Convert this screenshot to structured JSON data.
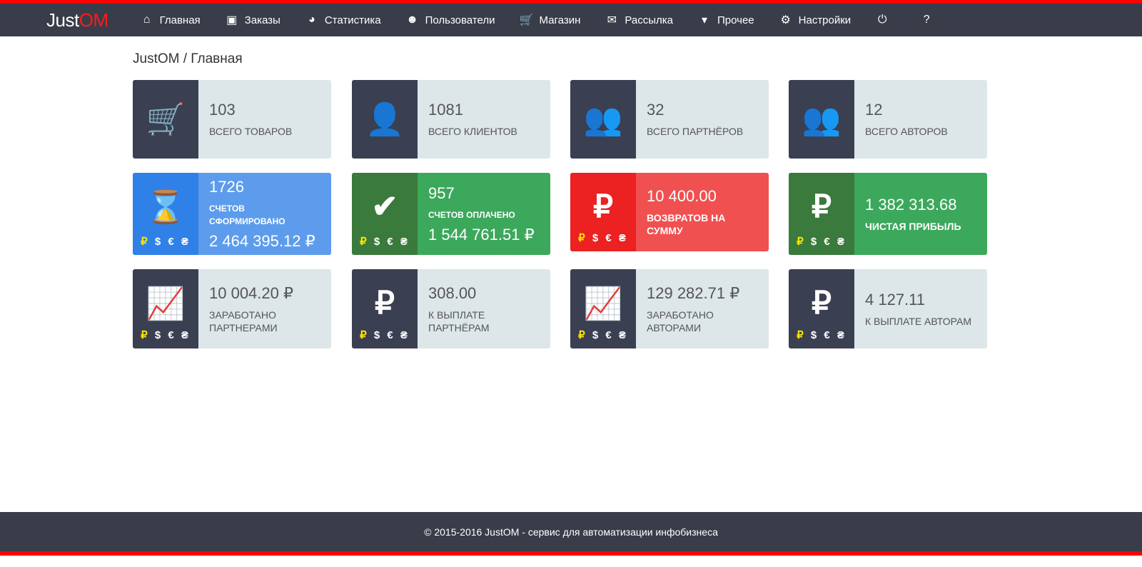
{
  "app": {
    "logo_a": "Just",
    "logo_b": "OM"
  },
  "nav": [
    {
      "icon": "home-icon",
      "glyph": "⌂",
      "label": "Главная"
    },
    {
      "icon": "money-icon",
      "glyph": "▣",
      "label": "Заказы"
    },
    {
      "icon": "pie-chart-icon",
      "glyph": "◕",
      "label": "Статистика"
    },
    {
      "icon": "users-icon",
      "glyph": "☻",
      "label": "Пользователи"
    },
    {
      "icon": "cart-icon",
      "glyph": "🛒",
      "label": "Магазин"
    },
    {
      "icon": "envelope-icon",
      "glyph": "✉",
      "label": "Рассылка"
    },
    {
      "icon": "dropdown-icon",
      "glyph": "▾",
      "label": "Прочее"
    },
    {
      "icon": "gears-icon",
      "glyph": "⚙",
      "label": "Настройки"
    },
    {
      "icon": "power-icon",
      "glyph": "⏻",
      "label": ""
    },
    {
      "icon": "help-icon",
      "glyph": "?",
      "label": ""
    }
  ],
  "breadcrumb": "JustOM / Главная",
  "currencies": [
    "₽",
    "$",
    "€",
    "₴"
  ],
  "cards": [
    {
      "icon": "cart-icon",
      "glyph": "🛒",
      "value": "103",
      "label": "Всего товаров"
    },
    {
      "icon": "user-icon",
      "glyph": "👤",
      "value": "1081",
      "label": "Всего клиентов"
    },
    {
      "icon": "users-icon",
      "glyph": "👥",
      "value": "32",
      "label": "Всего партнёров"
    },
    {
      "icon": "users-icon",
      "glyph": "👥",
      "value": "12",
      "label": "Всего авторов"
    },
    {
      "icon": "hourglass-icon",
      "glyph": "⌛",
      "value": "1726",
      "label": "Счетов сформировано",
      "sum": "2 464 395.12 ₽",
      "color": "blue"
    },
    {
      "icon": "check-icon",
      "glyph": "✔",
      "value": "957",
      "label": "Счетов оплачено",
      "sum": "1 544 761.51 ₽",
      "color": "green"
    },
    {
      "icon": "ruble-icon",
      "glyph": "₽",
      "value": "10 400.00",
      "label": "Возвратов на сумму",
      "color": "red"
    },
    {
      "icon": "ruble-icon",
      "glyph": "₽",
      "value": "1 382 313.68",
      "label": "Чистая прибыль",
      "color": "green"
    },
    {
      "icon": "line-chart-icon",
      "glyph": "📈",
      "value": "10 004.20 ₽",
      "label": "Заработано партнерами"
    },
    {
      "icon": "ruble-icon",
      "glyph": "₽",
      "value": "308.00",
      "label": "К выплате партнёрам"
    },
    {
      "icon": "line-chart-icon",
      "glyph": "📈",
      "value": "129 282.71 ₽",
      "label": "Заработано авторами"
    },
    {
      "icon": "ruble-icon",
      "glyph": "₽",
      "value": "4 127.11",
      "label": "К выплате авторам"
    }
  ],
  "footer": "© 2015-2016 JustOM - сервис для автоматизации инфобизнеса",
  "colors": {
    "nav": "#393d49",
    "accent": "#ff0000",
    "card": "#dde6e9",
    "blue": "#5d9cec",
    "green": "#3ca85c",
    "red": "#f05050"
  }
}
